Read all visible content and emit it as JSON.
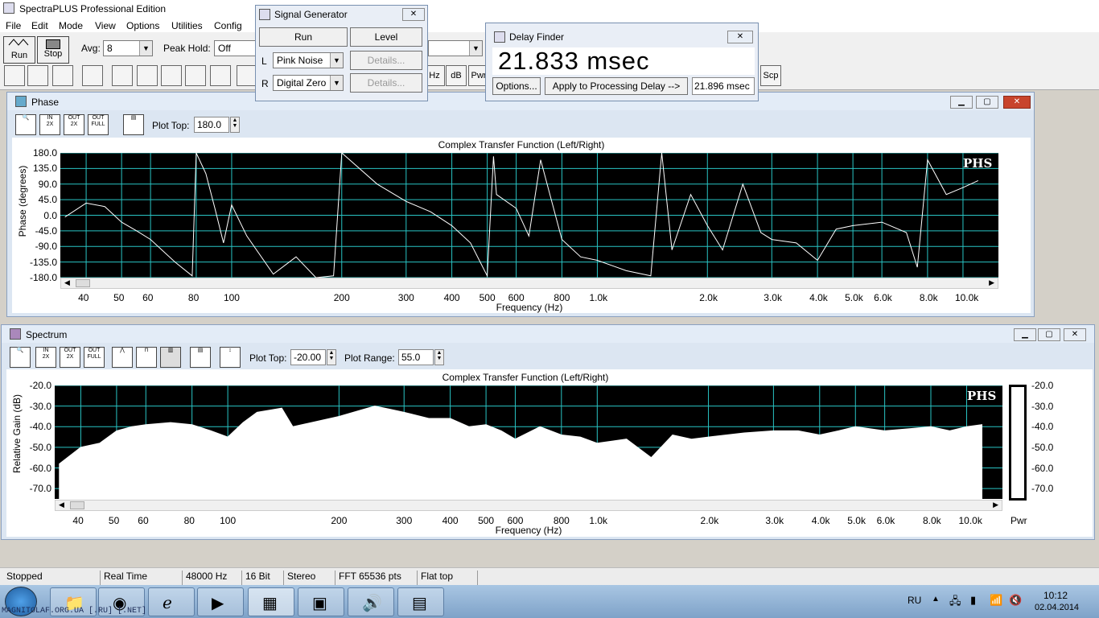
{
  "app": {
    "title": "SpectraPLUS Professional Edition"
  },
  "menu": [
    "File",
    "Edit",
    "Mode",
    "View",
    "Options",
    "Utilities",
    "Config"
  ],
  "toolbar": {
    "run": "Run",
    "stop": "Stop",
    "avg_label": "Avg:",
    "avg_value": "8",
    "peak_label": "Peak Hold:",
    "peak_value": "Off",
    "hz": "Hz",
    "db": "dB",
    "pwr": "Pwr",
    "scp": "Scp"
  },
  "signal_generator": {
    "title": "Signal Generator",
    "run": "Run",
    "level": "Level",
    "l": "L",
    "r": "R",
    "l_value": "Pink Noise",
    "r_value": "Digital Zero",
    "details": "Details..."
  },
  "delay_finder": {
    "title": "Delay Finder",
    "value": "21.833 msec",
    "options": "Options...",
    "apply": "Apply to Processing Delay -->",
    "applied": "21.896 msec"
  },
  "phase": {
    "title": "Phase",
    "plot_top_label": "Plot Top:",
    "plot_top": "180.0",
    "graph_title": "Complex Transfer Function (Left/Right)",
    "ylabel": "Phase (degrees)",
    "xlabel": "Frequency (Hz)",
    "badge": "PHS",
    "yticks": [
      "180.0",
      "135.0",
      "90.0",
      "45.0",
      "0.0",
      "-45.0",
      "-90.0",
      "-135.0",
      "-180.0"
    ],
    "xticks": [
      "40",
      "50",
      "60",
      "80",
      "100",
      "200",
      "300",
      "400",
      "500",
      "600",
      "800",
      "1.0k",
      "2.0k",
      "3.0k",
      "4.0k",
      "5.0k",
      "6.0k",
      "8.0k",
      "10.0k"
    ]
  },
  "spectrum": {
    "title": "Spectrum",
    "plot_top_label": "Plot Top:",
    "plot_top": "-20.00",
    "plot_range_label": "Plot Range:",
    "plot_range": "55.0",
    "graph_title": "Complex Transfer Function (Left/Right)",
    "ylabel": "Relative Gain (dB)",
    "xlabel": "Frequency (Hz)",
    "badge": "PHS",
    "pwr": "Pwr",
    "yticks": [
      "-20.0",
      "-30.0",
      "-40.0",
      "-50.0",
      "-60.0",
      "-70.0"
    ],
    "xticks": [
      "40",
      "50",
      "60",
      "80",
      "100",
      "200",
      "300",
      "400",
      "500",
      "600",
      "800",
      "1.0k",
      "2.0k",
      "3.0k",
      "4.0k",
      "5.0k",
      "6.0k",
      "8.0k",
      "10.0k"
    ]
  },
  "status": [
    "Stopped",
    "Real Time",
    "48000 Hz",
    "16 Bit",
    "Stereo",
    "FFT 65536 pts",
    "Flat top"
  ],
  "tray": {
    "lang": "RU",
    "time": "10:12",
    "date": "02.04.2014"
  },
  "watermark": "MAGNITOLAF.ORG.UA [.RU] [.NET]",
  "chart_data": [
    {
      "type": "line",
      "title": "Complex Transfer Function (Left/Right)",
      "xlabel": "Frequency (Hz)",
      "ylabel": "Phase (degrees)",
      "ylim": [
        -180,
        180
      ],
      "xscale": "log",
      "grid": true,
      "series": [
        {
          "x": [
            35,
            40,
            45,
            50,
            55,
            60,
            70,
            78,
            80,
            85,
            90,
            95,
            100,
            110,
            130,
            150,
            170,
            190,
            200,
            250,
            300,
            350,
            400,
            450,
            500,
            520,
            530,
            600,
            650,
            700,
            800,
            900,
            1000,
            1200,
            1400,
            1500,
            1600,
            1800,
            2000,
            2200,
            2500,
            2800,
            3000,
            3500,
            4000,
            4500,
            5000,
            6000,
            7000,
            7500,
            8000,
            9000,
            10000,
            11000
          ],
          "y": [
            -5,
            35,
            25,
            -20,
            -45,
            -70,
            -135,
            -175,
            180,
            120,
            20,
            -80,
            30,
            -60,
            -170,
            -120,
            -180,
            -175,
            180,
            90,
            40,
            10,
            -30,
            -80,
            -175,
            170,
            60,
            20,
            -60,
            160,
            -70,
            -120,
            -130,
            -160,
            -175,
            180,
            -100,
            60,
            -30,
            -100,
            90,
            -50,
            -70,
            -80,
            -130,
            -40,
            -30,
            -20,
            -50,
            -150,
            160,
            60,
            80,
            100
          ]
        }
      ]
    },
    {
      "type": "area",
      "title": "Complex Transfer Function (Left/Right)",
      "xlabel": "Frequency (Hz)",
      "ylabel": "Relative Gain (dB)",
      "ylim": [
        -75,
        -20
      ],
      "xscale": "log",
      "grid": true,
      "series": [
        {
          "x": [
            35,
            40,
            45,
            50,
            55,
            60,
            70,
            80,
            90,
            100,
            110,
            120,
            140,
            150,
            200,
            250,
            300,
            350,
            400,
            450,
            500,
            550,
            600,
            700,
            800,
            900,
            1000,
            1200,
            1400,
            1600,
            1800,
            2000,
            2500,
            3000,
            3500,
            4000,
            4500,
            5000,
            6000,
            7000,
            8000,
            9000,
            10000,
            11000
          ],
          "y": [
            -58,
            -50,
            -48,
            -42,
            -40,
            -39,
            -38,
            -39,
            -42,
            -45,
            -38,
            -33,
            -31,
            -40,
            -35,
            -30,
            -33,
            -36,
            -36,
            -40,
            -39,
            -42,
            -46,
            -40,
            -44,
            -45,
            -48,
            -46,
            -55,
            -44,
            -46,
            -45,
            -43,
            -42,
            -42,
            -44,
            -42,
            -40,
            -42,
            -41,
            -40,
            -42,
            -40,
            -39
          ]
        }
      ]
    }
  ]
}
